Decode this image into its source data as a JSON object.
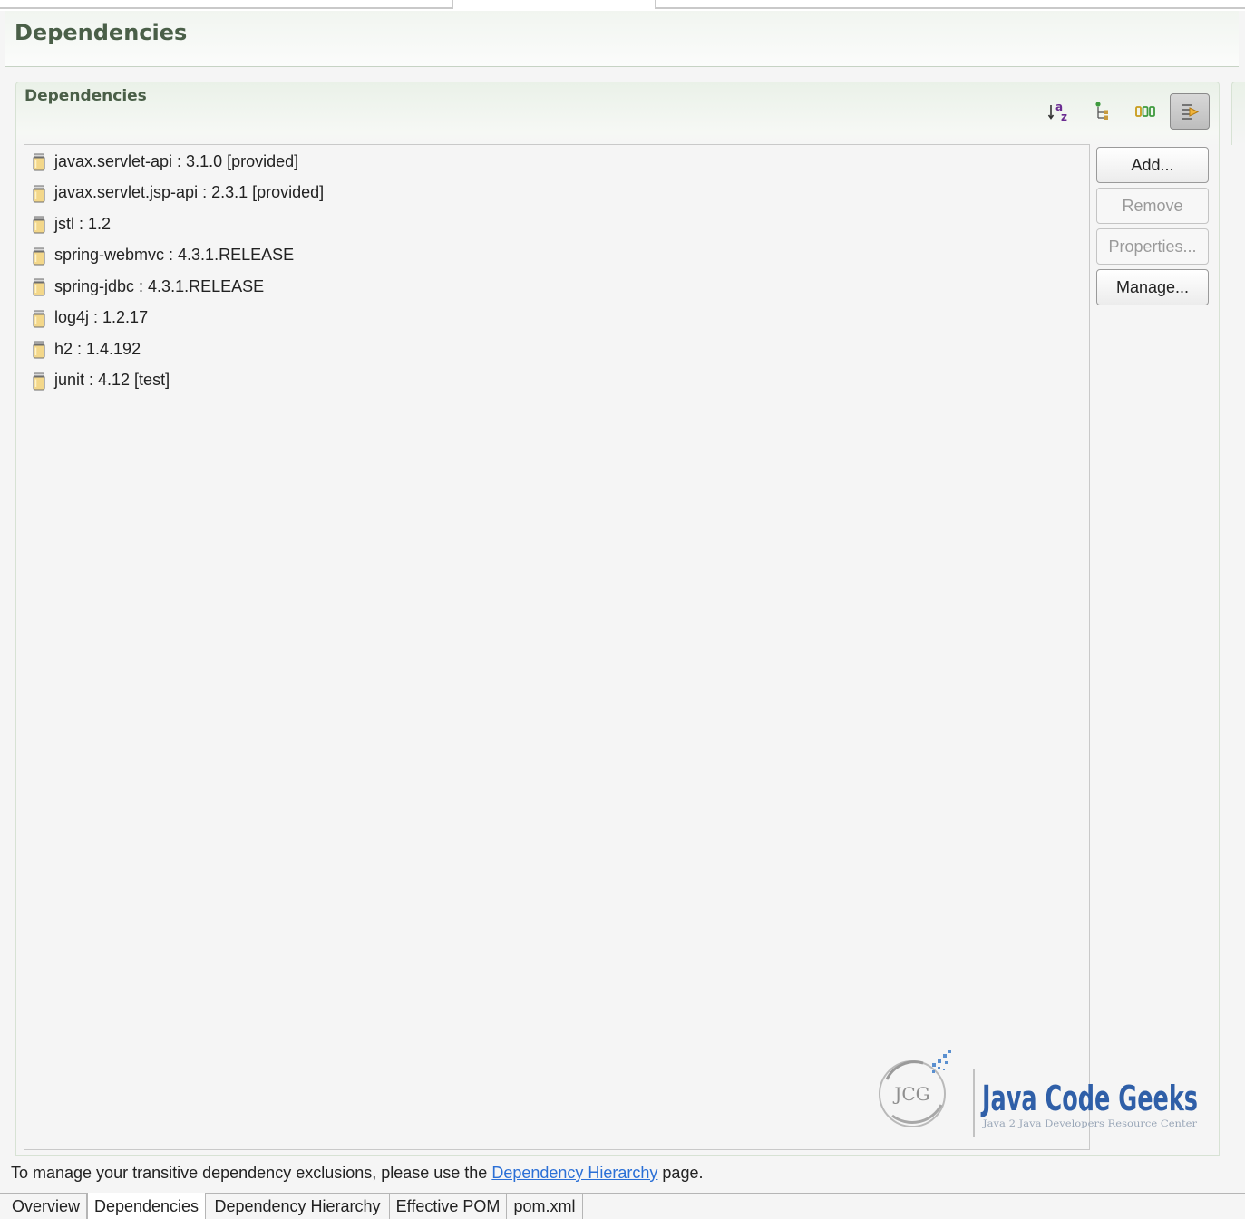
{
  "form": {
    "title": "Dependencies"
  },
  "section": {
    "title": "Dependencies",
    "toolbar": [
      {
        "name": "sort-alphabetically-icon"
      },
      {
        "name": "show-group-id-icon"
      },
      {
        "name": "show-version-icon"
      },
      {
        "name": "filter-icon",
        "pressed": true
      }
    ]
  },
  "dependencies": [
    {
      "label": "javax.servlet-api : 3.1.0 [provided]"
    },
    {
      "label": "javax.servlet.jsp-api : 2.3.1 [provided]"
    },
    {
      "label": "jstl : 1.2"
    },
    {
      "label": "spring-webmvc : 4.3.1.RELEASE"
    },
    {
      "label": "spring-jdbc : 4.3.1.RELEASE"
    },
    {
      "label": "log4j : 1.2.17"
    },
    {
      "label": "h2 : 1.4.192"
    },
    {
      "label": "junit : 4.12 [test]"
    }
  ],
  "buttons": {
    "add": "Add...",
    "remove": "Remove",
    "properties": "Properties...",
    "manage": "Manage..."
  },
  "watermark": {
    "initials": "JCG",
    "name": "Java Code Geeks",
    "tagline": "Java 2 Java Developers Resource Center"
  },
  "footer": {
    "prefix": "To manage your transitive dependency exclusions, please use the ",
    "link": "Dependency Hierarchy",
    "suffix": " page."
  },
  "tabs": [
    {
      "label": "Overview",
      "active": false
    },
    {
      "label": "Dependencies",
      "active": true
    },
    {
      "label": "Dependency Hierarchy",
      "active": false
    },
    {
      "label": "Effective POM",
      "active": false
    },
    {
      "label": "pom.xml",
      "active": false
    }
  ],
  "colors": {
    "title_green": "#4a5f48",
    "link_blue": "#2a6fd6",
    "jar_icon": "#e8c170"
  }
}
